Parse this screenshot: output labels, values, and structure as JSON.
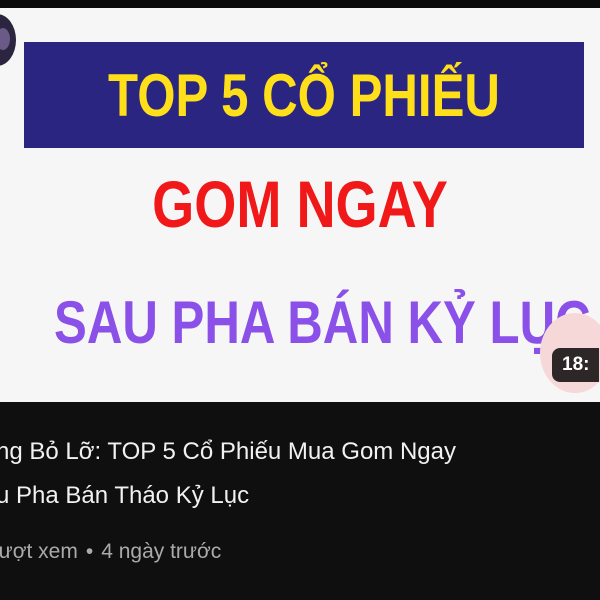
{
  "thumbnail": {
    "banner_text": "TOP 5 CỔ PHIẾU",
    "line2": "GOM NGAY",
    "line3": "SAU PHA BÁN KỶ LỤC",
    "duration": "18:",
    "colors": {
      "banner_bg": "#2a2580",
      "banner_text": "#ffde1a",
      "line2": "#f01818",
      "line3": "#8a50e8"
    }
  },
  "video": {
    "title_line1": "ng Bỏ Lỡ: TOP 5 Cổ Phiếu Mua Gom Ngay",
    "title_line2": "u Pha Bán Tháo Kỷ Lục",
    "views": "lượt xem",
    "separator": "•",
    "age": "4 ngày trước"
  }
}
